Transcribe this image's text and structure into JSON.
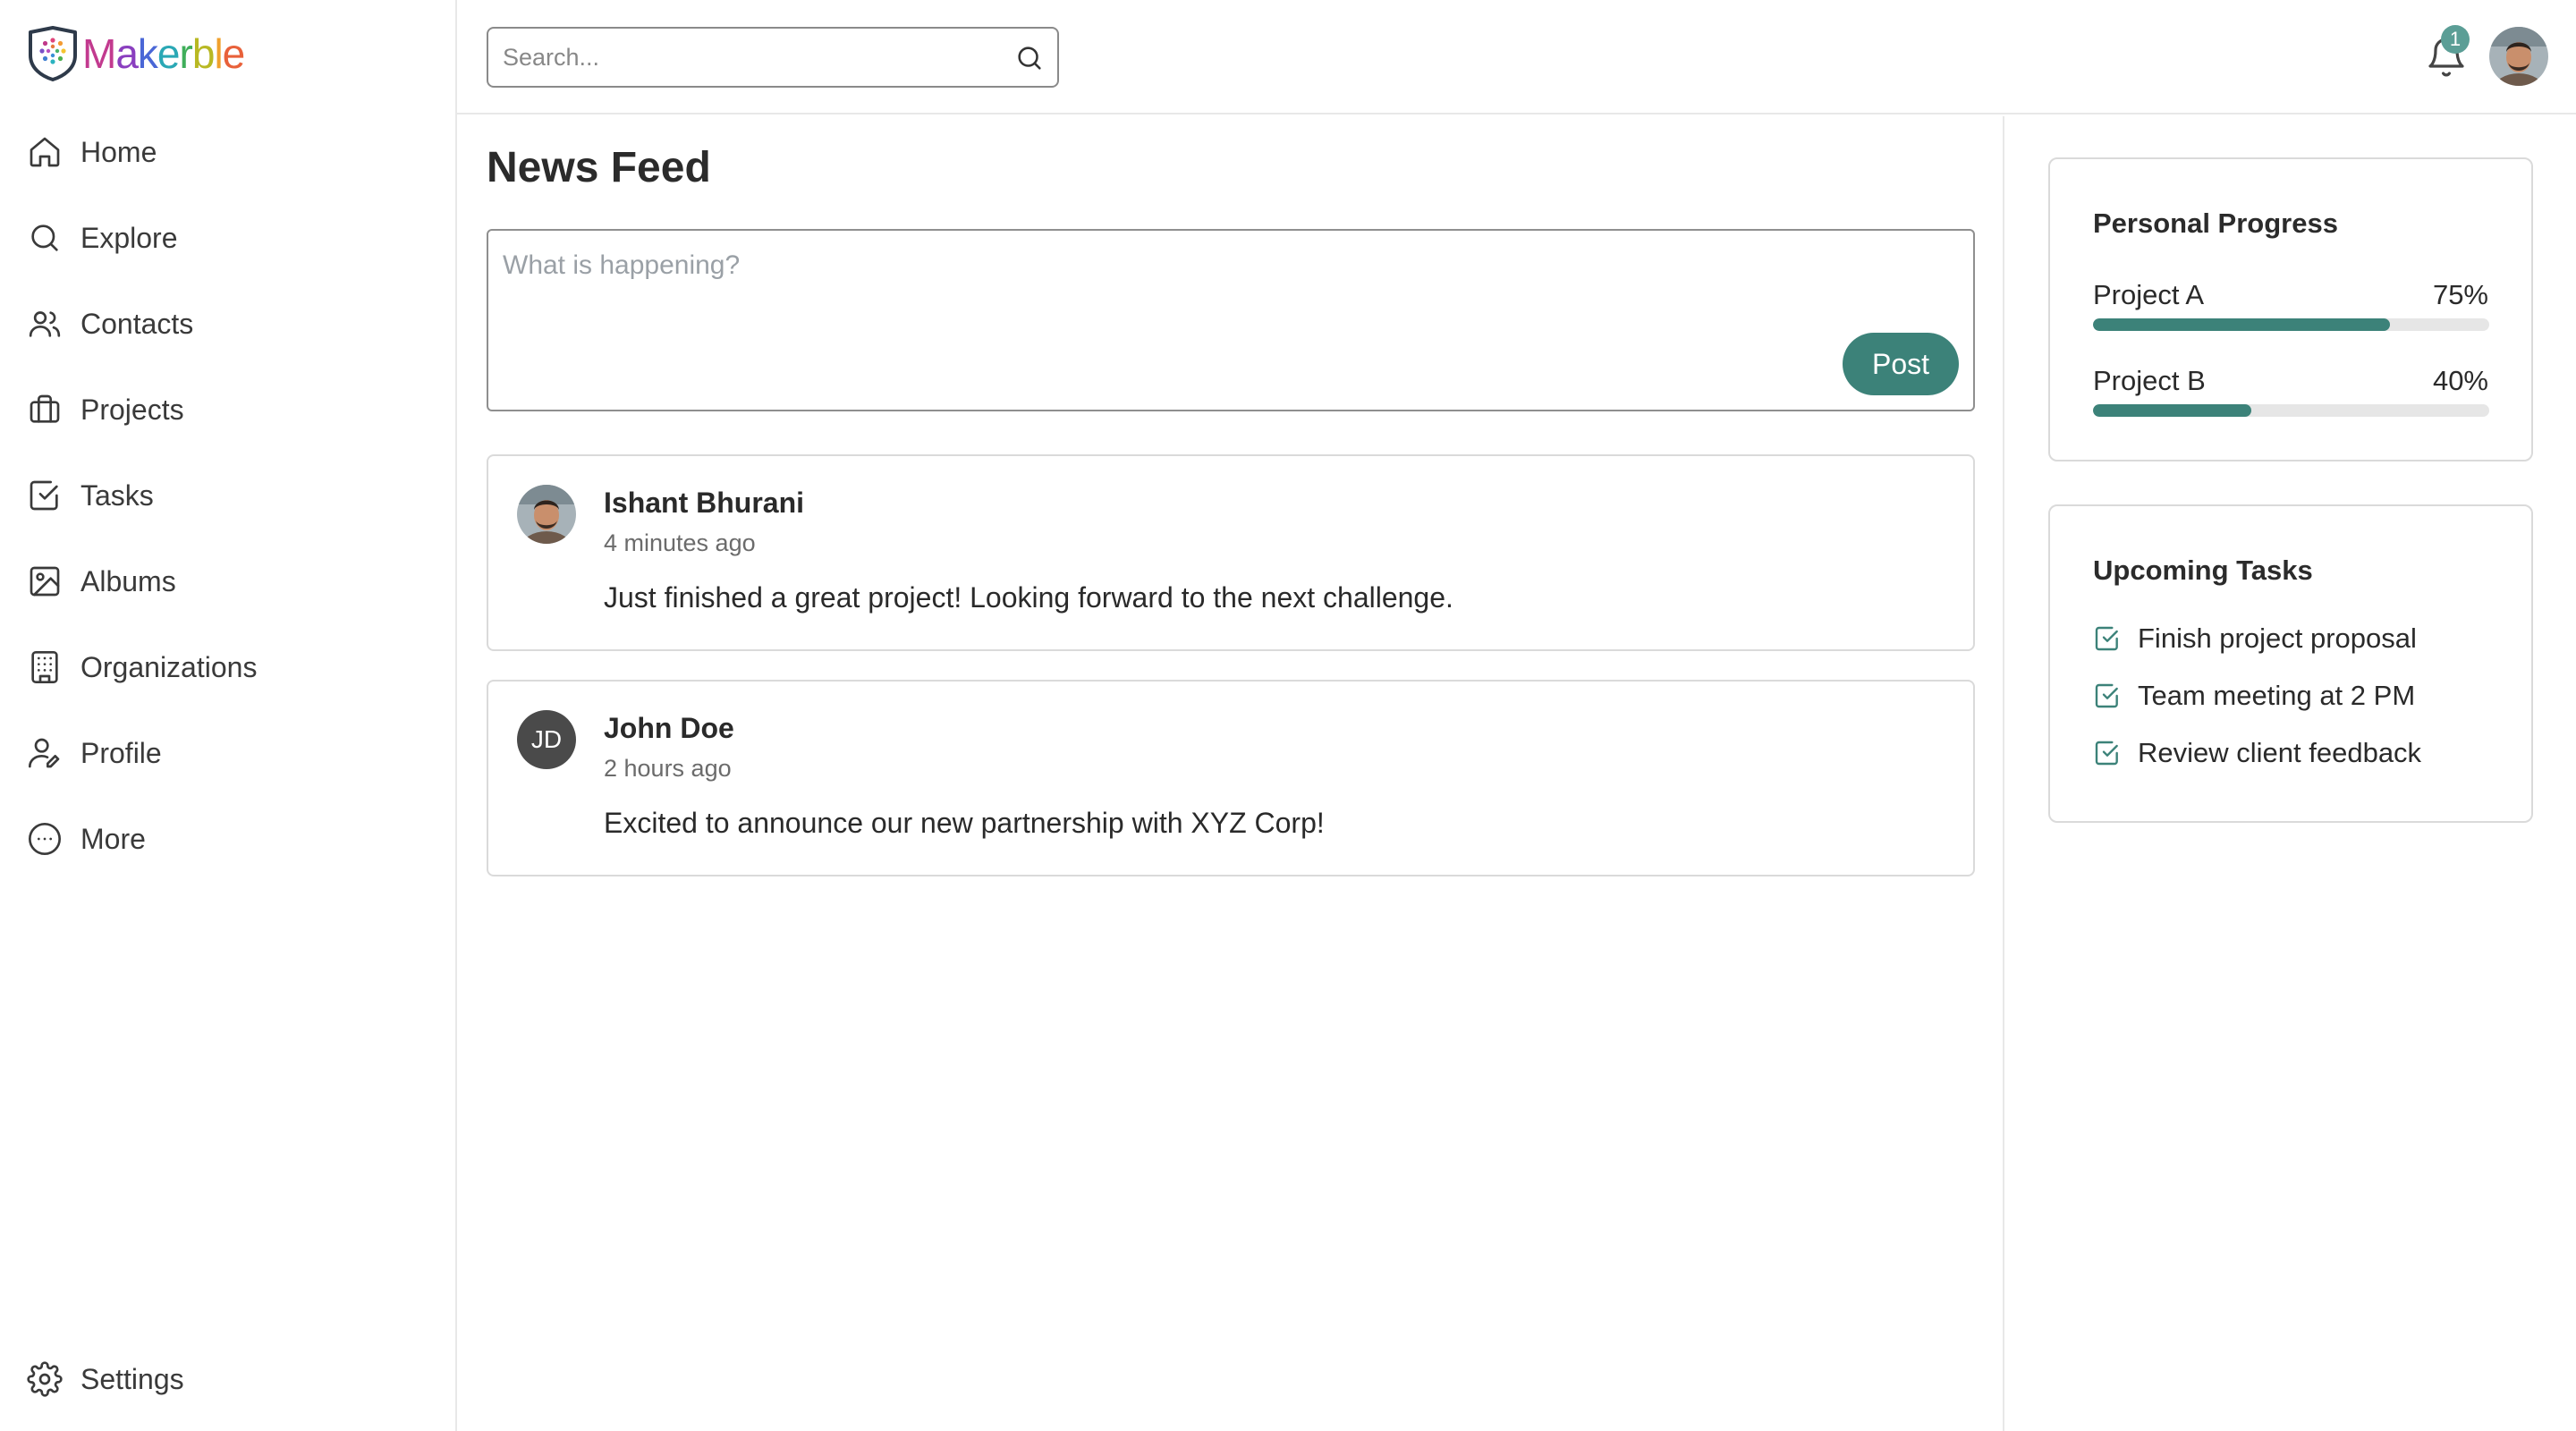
{
  "brand": {
    "name": "Makerble"
  },
  "sidebar": {
    "items": [
      {
        "label": "Home",
        "icon": "home-icon"
      },
      {
        "label": "Explore",
        "icon": "search-icon"
      },
      {
        "label": "Contacts",
        "icon": "users-icon"
      },
      {
        "label": "Projects",
        "icon": "briefcase-icon"
      },
      {
        "label": "Tasks",
        "icon": "checkbox-icon"
      },
      {
        "label": "Albums",
        "icon": "image-icon"
      },
      {
        "label": "Organizations",
        "icon": "building-icon"
      },
      {
        "label": "Profile",
        "icon": "user-edit-icon"
      },
      {
        "label": "More",
        "icon": "more-circle-icon"
      }
    ],
    "settings_label": "Settings"
  },
  "topbar": {
    "search_placeholder": "Search...",
    "notification_count": "1"
  },
  "feed": {
    "title": "News Feed",
    "composer_placeholder": "What is happening?",
    "post_button": "Post",
    "posts": [
      {
        "author": "Ishant Bhurani",
        "time": "4 minutes ago",
        "text": "Just finished a great project! Looking forward to the next challenge.",
        "avatar": "photo"
      },
      {
        "author": "John Doe",
        "time": "2 hours ago",
        "text": "Excited to announce our new partnership with XYZ Corp!",
        "initials": "JD"
      }
    ]
  },
  "progress": {
    "title": "Personal Progress",
    "items": [
      {
        "label": "Project A",
        "value": "75%",
        "fraction": 0.75
      },
      {
        "label": "Project B",
        "value": "40%",
        "fraction": 0.4
      }
    ]
  },
  "tasks": {
    "title": "Upcoming Tasks",
    "items": [
      {
        "label": "Finish project proposal"
      },
      {
        "label": "Team meeting at 2 PM"
      },
      {
        "label": "Review client feedback"
      }
    ]
  },
  "colors": {
    "accent": "#3c8279",
    "badge": "#5b9e96",
    "border": "#dadada"
  }
}
